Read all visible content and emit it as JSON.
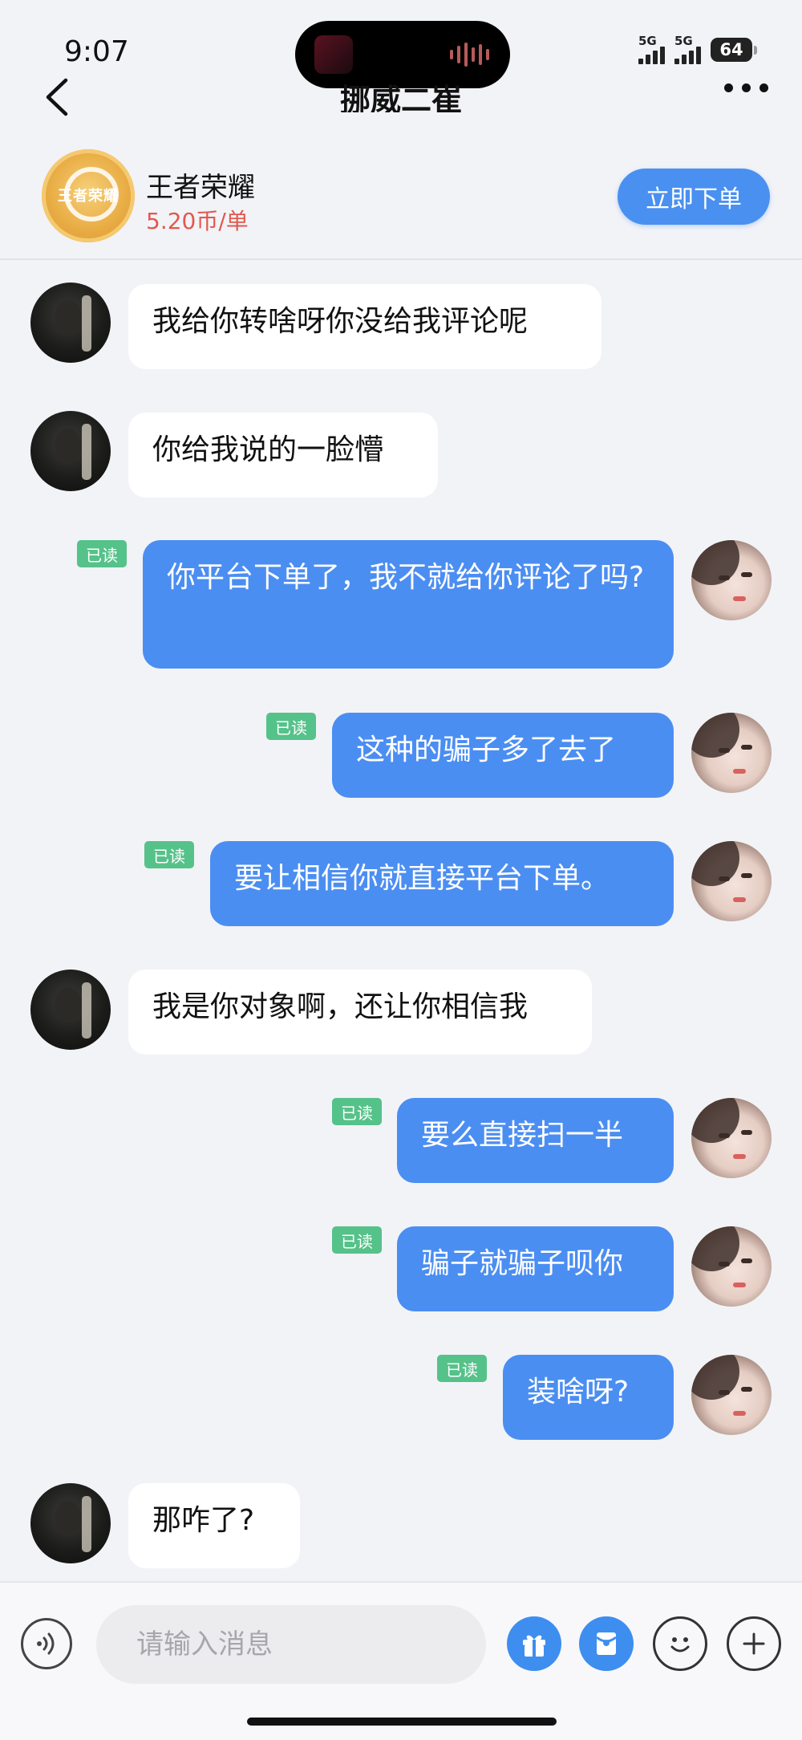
{
  "status_bar": {
    "time": "9:07",
    "signal1_label": "5G",
    "signal2_label": "5G",
    "battery": "64"
  },
  "nav": {
    "title": "挪威二崔",
    "back_icon": "chevron-left-icon",
    "more_icon": "more-dots-icon"
  },
  "product": {
    "icon_text": "王者荣耀",
    "name": "王者荣耀",
    "price": "5.20币/单",
    "order_button": "立即下单"
  },
  "read_label": "已读",
  "messages": [
    {
      "side": "left",
      "text": "我给你转啥呀你没给我评论呢"
    },
    {
      "side": "left",
      "text": "你给我说的一脸懵"
    },
    {
      "side": "right",
      "text": "你平台下单了，我不就给你评论了吗?",
      "read": true
    },
    {
      "side": "right",
      "text": "这种的骗子多了去了",
      "read": true
    },
    {
      "side": "right",
      "text": "要让相信你就直接平台下单。",
      "read": true
    },
    {
      "side": "left",
      "text": "我是你对象啊，还让你相信我"
    },
    {
      "side": "right",
      "text": "要么直接扫一半",
      "read": true
    },
    {
      "side": "right",
      "text": "骗子就骗子呗你",
      "read": true
    },
    {
      "side": "right",
      "text": "装啥呀?",
      "read": true
    },
    {
      "side": "left",
      "text": "那咋了?"
    }
  ],
  "input": {
    "placeholder": "请输入消息"
  },
  "colors": {
    "accent_blue": "#4b8ef2",
    "price_red": "#e2584e",
    "read_green": "#55c28a"
  }
}
